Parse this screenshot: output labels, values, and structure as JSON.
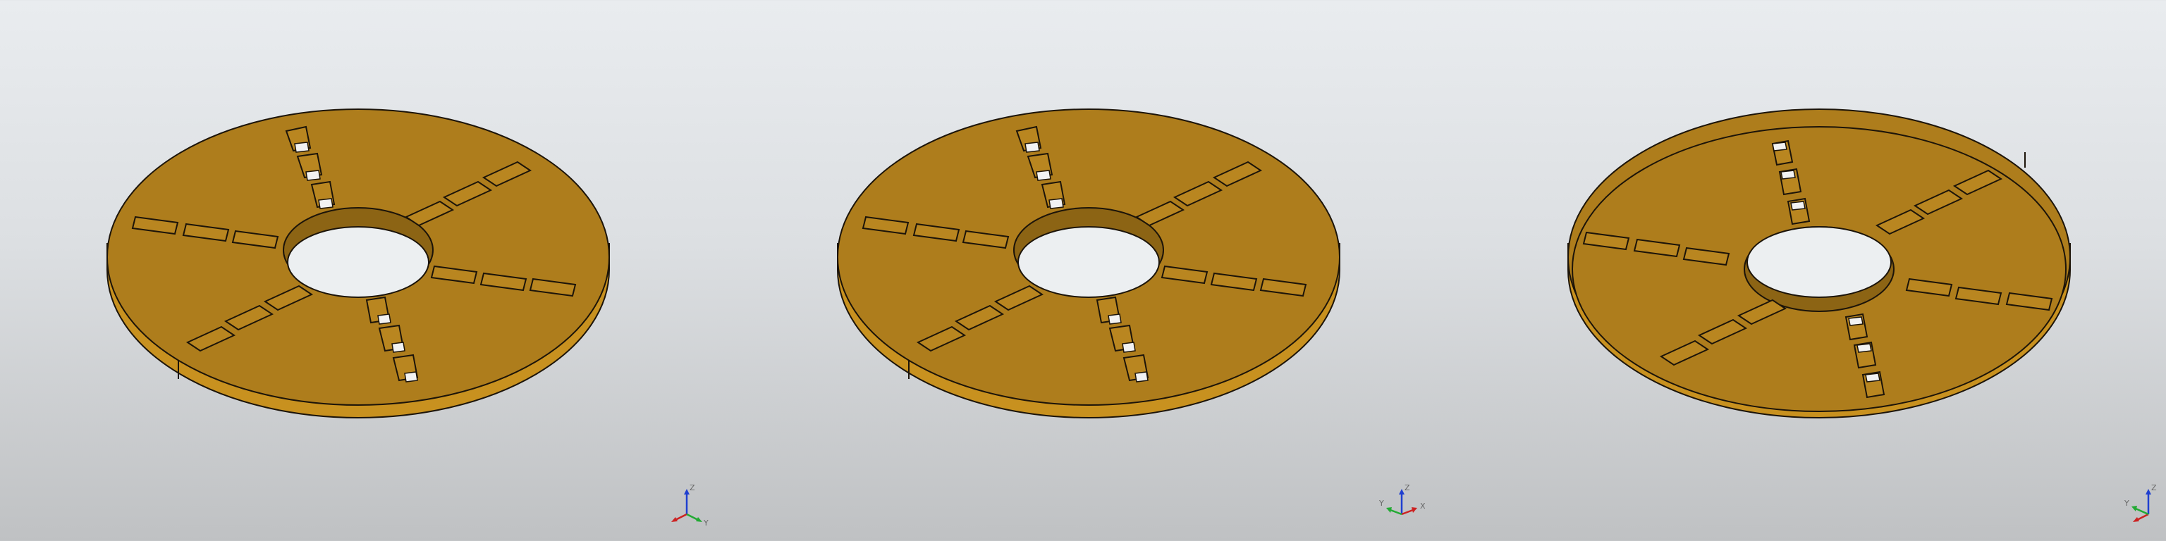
{
  "colors": {
    "part_face": "#ae7d1c",
    "part_side": "#c8911f",
    "edge": "#1c1409",
    "hole": "#eceff1",
    "axis_x": "#cc2222",
    "axis_y": "#22aa33",
    "axis_z": "#1f3fd0"
  },
  "viewports": [
    {
      "id": "view-1",
      "part": "slotted-disk",
      "triad": {
        "labels": {
          "z": "Z",
          "x": "",
          "y": "Y"
        }
      }
    },
    {
      "id": "view-2",
      "part": "slotted-disk",
      "triad": {
        "labels": {
          "z": "Z",
          "x": "X",
          "y": "Y"
        }
      }
    },
    {
      "id": "view-3",
      "part": "slotted-disk-with-rim",
      "triad": {
        "labels": {
          "z": "Z",
          "x": "",
          "y": "Y"
        }
      }
    }
  ]
}
